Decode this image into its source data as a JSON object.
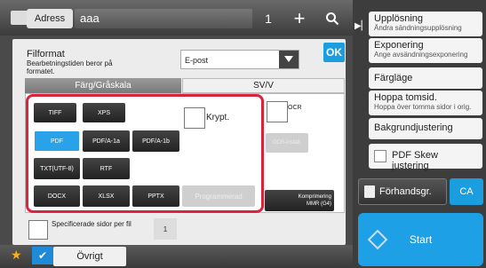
{
  "topbar": {
    "address_tab": "Adress",
    "address_value": "aaa",
    "count": "1"
  },
  "right_panel": {
    "items": [
      {
        "title": "Upplösning",
        "sub": "Ändra sändningsupplösning"
      },
      {
        "title": "Exponering",
        "sub": "Ange avsändningsexponering"
      },
      {
        "title": "Färgläge",
        "sub": ""
      },
      {
        "title": "Hoppa tomsid.",
        "sub": "Hoppa över tomma sidor i orig."
      },
      {
        "title": "Bakgrundjustering",
        "sub": ""
      },
      {
        "title": "PDF Skew justering",
        "sub": ""
      }
    ],
    "preview": "Förhandsgr.",
    "ca": "CA",
    "start": "Start"
  },
  "dialog": {
    "ok": "OK",
    "file_format_title": "Filformat",
    "file_format_sub": "Bearbetningstiden beror på formatet.",
    "select_value": "E-post",
    "tab_color": "Färg/Gråskala",
    "tab_bw": "SV/V",
    "formats": {
      "tiff": "TIFF",
      "xps": "XPS",
      "pdf": "PDF",
      "pdfa1a": "PDF/A-1a",
      "pdfa1b": "PDF/A-1b",
      "txt": "TXT(UTF-8)",
      "rtf": "RTF",
      "docx": "DOCX",
      "xlsx": "XLSX",
      "pptx": "PPTX"
    },
    "programmed": "Programmerad",
    "krypt": "Krypt.",
    "ocr": "OCR",
    "ocr_settings": "OCR-inställ.",
    "compression": "Komprimering",
    "compression_value": "MMR (G4)",
    "specified_pages": "Specificerade sidor per fil",
    "specified_num": "1"
  },
  "bottombar": {
    "other": "Övrigt"
  },
  "colors": {
    "accent": "#1a9ee0",
    "highlight": "#d9243c",
    "selected": "#2aa2ea"
  }
}
